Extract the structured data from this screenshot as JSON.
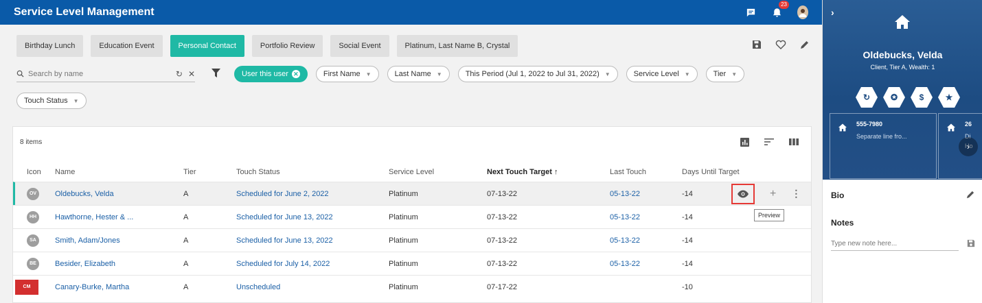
{
  "app": {
    "title": "Service Level Management",
    "notification_count": "23"
  },
  "event_chips": [
    {
      "label": "Birthday Lunch",
      "active": false
    },
    {
      "label": "Education Event",
      "active": false
    },
    {
      "label": "Personal Contact",
      "active": true
    },
    {
      "label": "Portfolio Review",
      "active": false
    },
    {
      "label": "Social Event",
      "active": false
    },
    {
      "label": "Platinum, Last Name B, Crystal",
      "active": false
    }
  ],
  "search": {
    "placeholder": "Search by name",
    "value": ""
  },
  "filters": {
    "user_pill": "User this user",
    "pills": [
      "First Name",
      "Last Name",
      "This Period (Jul 1, 2022 to Jul 31, 2022)",
      "Service Level",
      "Tier"
    ],
    "touch_status": "Touch Status"
  },
  "grid": {
    "items_count": "8 items",
    "columns": {
      "icon": "Icon",
      "name": "Name",
      "tier": "Tier",
      "touch_status": "Touch Status",
      "service_level": "Service Level",
      "next_touch": "Next Touch Target",
      "last_touch": "Last Touch",
      "days_until": "Days Until Target"
    },
    "rows": [
      {
        "initials": "OV",
        "name": "Oldebucks, Velda",
        "tier": "A",
        "status": "Scheduled for June 2, 2022",
        "service": "Platinum",
        "next": "07-13-22",
        "last": "05-13-22",
        "days": "-14"
      },
      {
        "initials": "HH",
        "name": "Hawthorne, Hester & ...",
        "tier": "A",
        "status": "Scheduled for June 13, 2022",
        "service": "Platinum",
        "next": "07-13-22",
        "last": "05-13-22",
        "days": "-14"
      },
      {
        "initials": "SA",
        "name": "Smith, Adam/Jones",
        "tier": "A",
        "status": "Scheduled for June 13, 2022",
        "service": "Platinum",
        "next": "07-13-22",
        "last": "05-13-22",
        "days": "-14"
      },
      {
        "initials": "BE",
        "name": "Besider, Elizabeth",
        "tier": "A",
        "status": "Scheduled for July 14, 2022",
        "service": "Platinum",
        "next": "07-13-22",
        "last": "05-13-22",
        "days": "-14"
      },
      {
        "initials": "CM",
        "name": "Canary-Burke, Martha",
        "tier": "A",
        "status": "Unscheduled",
        "service": "Platinum",
        "next": "07-17-22",
        "last": "",
        "days": "-10"
      }
    ],
    "tooltip": "Preview"
  },
  "panel": {
    "name": "Oldebucks, Velda",
    "subtitle": "Client, Tier A, Wealth: 1",
    "contact1": {
      "phone": "555-7980",
      "sub": "Separate line fro..."
    },
    "contact2": {
      "phone": "26",
      "sub": "Di",
      "sub2": "Ho"
    },
    "bio_label": "Bio",
    "notes_label": "Notes",
    "note_placeholder": "Type new note here..."
  },
  "colors": {
    "brand": "#0a5aa8",
    "accent": "#1fb9a5",
    "highlight": "#e53935"
  }
}
